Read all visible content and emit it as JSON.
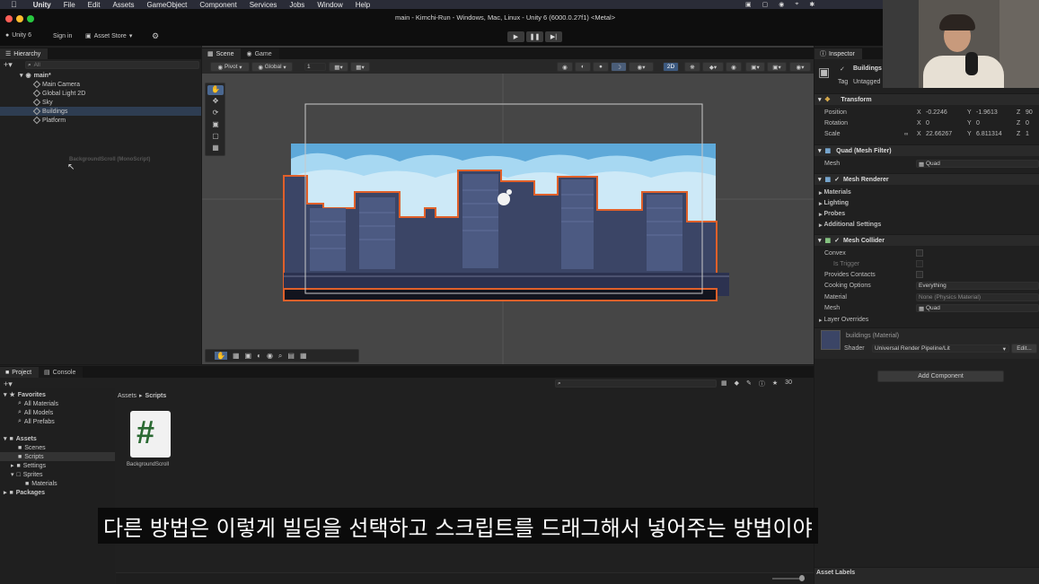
{
  "menubar": {
    "app": "Unity",
    "items": [
      "File",
      "Edit",
      "Assets",
      "GameObject",
      "Component",
      "Services",
      "Jobs",
      "Window",
      "Help"
    ]
  },
  "title": "main - Kimchi-Run - Windows, Mac, Linux - Unity 6 (6000.0.27f1) <Metal>",
  "toolbar": {
    "account": "Unity 6",
    "sign_in": "Sign in",
    "asset_store": "Asset Store"
  },
  "hierarchy": {
    "tab": "Hierarchy",
    "search_placeholder": "All",
    "scene": "main*",
    "items": [
      "Main Camera",
      "Global Light 2D",
      "Sky",
      "Buildings",
      "Platform"
    ],
    "drag_label": "BackgroundScroll (MonoScript)"
  },
  "scene": {
    "tabs": [
      "Scene",
      "Game"
    ],
    "pivot": "Pivot",
    "global": "Global",
    "snap_value": "1",
    "mode_2d": "2D"
  },
  "inspector": {
    "tab": "Inspector",
    "object_name": "Buildings",
    "tag_label": "Tag",
    "tag_value": "Untagged",
    "transform": {
      "title": "Transform",
      "position": {
        "label": "Position",
        "x": "-0.2246",
        "y": "-1.9613",
        "z": "90"
      },
      "rotation": {
        "label": "Rotation",
        "x": "0",
        "y": "0",
        "z": "0"
      },
      "scale": {
        "label": "Scale",
        "x": "22.66267",
        "y": "6.811314",
        "z": "1"
      }
    },
    "mesh_filter": {
      "title": "Quad (Mesh Filter)",
      "mesh_label": "Mesh",
      "mesh_value": "Quad"
    },
    "mesh_renderer": {
      "title": "Mesh Renderer",
      "sections": [
        "Materials",
        "Lighting",
        "Probes",
        "Additional Settings"
      ]
    },
    "mesh_collider": {
      "title": "Mesh Collider",
      "convex": "Convex",
      "is_trigger": "Is Trigger",
      "provides_contacts": "Provides Contacts",
      "cooking_label": "Cooking Options",
      "cooking_value": "Everything",
      "material_label": "Material",
      "material_value": "None (Physics Material)",
      "mesh_label": "Mesh",
      "mesh_value": "Quad",
      "layer_overrides": "Layer Overrides"
    },
    "material": {
      "name": "buildings (Material)",
      "shader_label": "Shader",
      "shader_value": "Universal Render Pipeline/Lit",
      "edit": "Edit..."
    },
    "add_component": "Add Component",
    "asset_labels": "Asset Labels"
  },
  "project": {
    "tabs": [
      "Project",
      "Console"
    ],
    "favorites": "Favorites",
    "fav_items": [
      "All Materials",
      "All Models",
      "All Prefabs"
    ],
    "assets": "Assets",
    "asset_items": [
      "Scenes",
      "Scripts",
      "Settings",
      "Sprites"
    ],
    "sprite_child": "Materials",
    "packages": "Packages",
    "breadcrumb_root": "Assets",
    "breadcrumb_current": "Scripts",
    "file_name": "BackgroundScroll",
    "file_glyph": "#",
    "count": "30"
  },
  "subtitle": "다른 방법은 이렇게 빌딩을 선택하고 스크립트를 드래그해서 넣어주는 방법이야",
  "colors": {
    "selection_orange": "#e0602a",
    "sky_blue": "#5ea9d9",
    "building_navy": "#3b4566",
    "script_green": "#2b6a33"
  }
}
